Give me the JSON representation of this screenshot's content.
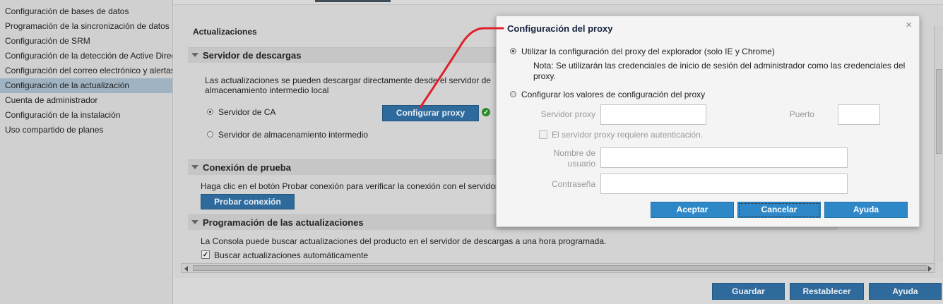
{
  "sidebar": {
    "items": [
      {
        "label": "Configuración de bases de datos"
      },
      {
        "label": "Programación de la sincronización de datos"
      },
      {
        "label": "Configuración de SRM"
      },
      {
        "label": "Configuración de la detección de Active Directory"
      },
      {
        "label": "Configuración del correo electrónico y alertas"
      },
      {
        "label": "Configuración de la actualización"
      },
      {
        "label": "Cuenta de administrador"
      },
      {
        "label": "Configuración de la instalación"
      },
      {
        "label": "Uso compartido de planes"
      }
    ],
    "active_index": 5
  },
  "main": {
    "title": "Actualizaciones",
    "download_section": {
      "heading": "Servidor de descargas",
      "description_line1": "Las actualizaciones se pueden descargar directamente desde el servidor de",
      "description_line2": "almacenamiento intermedio local",
      "option_ca": "Servidor de CA",
      "option_staging": "Servidor de almacenamiento intermedio",
      "configure_proxy_button": "Configurar proxy"
    },
    "test_section": {
      "heading": "Conexión de prueba",
      "description": "Haga clic en el botón Probar conexión para verificar la conexión con el servidor",
      "test_button": "Probar conexión"
    },
    "schedule_section": {
      "heading": "Programación de las actualizaciones",
      "description": "La Consola puede buscar actualizaciones del producto en el servidor de descargas a una hora programada.",
      "auto_check_label": "Buscar actualizaciones automáticamente",
      "auto_check_checked": true
    }
  },
  "footer": {
    "save": "Guardar",
    "reset": "Restablecer",
    "help": "Ayuda"
  },
  "dialog": {
    "title": "Configuración del proxy",
    "close_glyph": "×",
    "option_browser": "Utilizar la configuración del proxy del explorador (solo IE y Chrome)",
    "note_line1": "Nota: Se utilizarán las credenciales de inicio de sesión del administrador como las credenciales del",
    "note_line2": "proxy.",
    "option_manual": "Configurar los valores de configuración del proxy",
    "proxy_server_label": "Servidor proxy",
    "port_label": "Puerto",
    "auth_label": "El servidor proxy requiere autenticación.",
    "username_label_line1": "Nombre de",
    "username_label_line2": "usuario",
    "password_label": "Contraseña",
    "accept": "Aceptar",
    "cancel": "Cancelar",
    "help": "Ayuda"
  },
  "colors": {
    "accent_blue": "#2e88c8",
    "dark_button": "#2e6b9c",
    "annotation_red": "#e0202a",
    "success_green": "#2c8a2c"
  },
  "icons": {
    "success": "check-circle-icon",
    "collapse": "triangle-down-icon",
    "close": "close-icon"
  }
}
